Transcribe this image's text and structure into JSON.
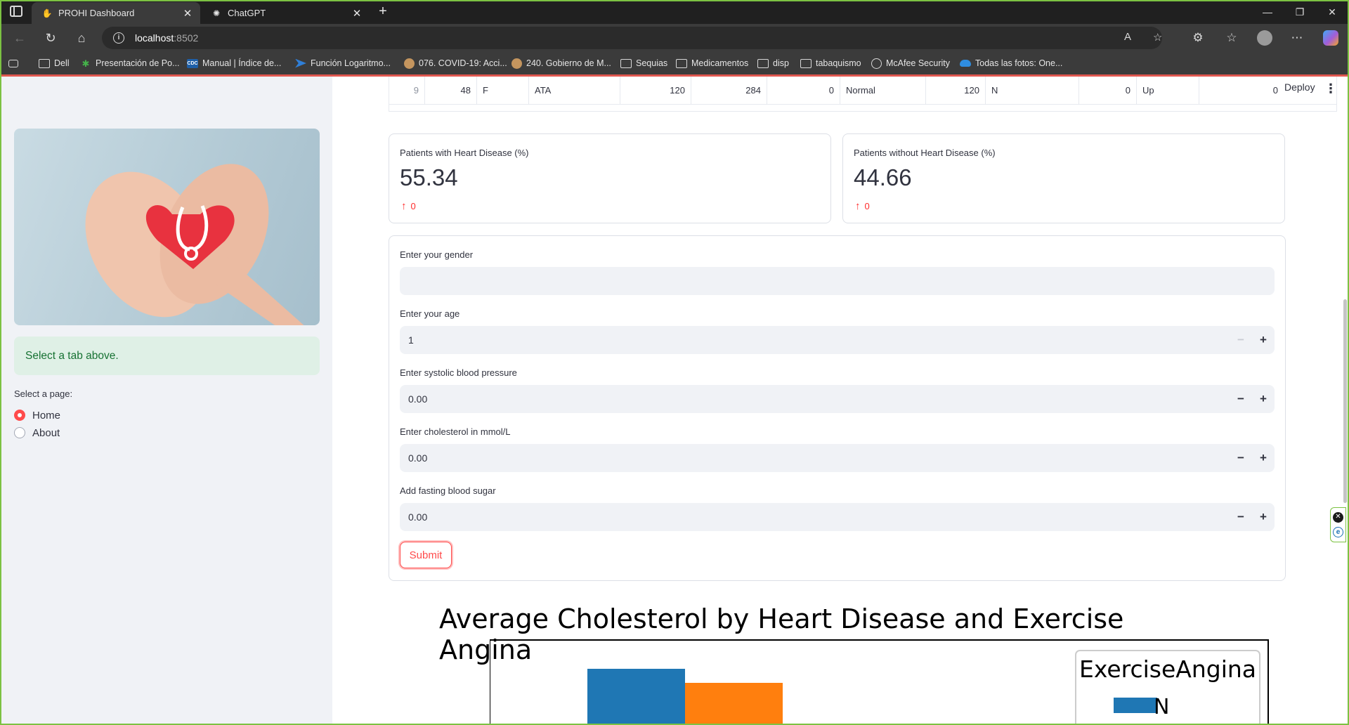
{
  "browser": {
    "tabs": [
      {
        "title": "PROHI Dashboard",
        "active": true
      },
      {
        "title": "ChatGPT",
        "active": false
      }
    ],
    "new_tab": "+",
    "url_host": "localhost",
    "url_port": ":8502",
    "bookmarks": [
      {
        "label": "Dell",
        "icon": "folder"
      },
      {
        "label": "Presentación de Po...",
        "icon": "green"
      },
      {
        "label": "Manual | Índice de...",
        "icon": "cdc"
      },
      {
        "label": "Función Logaritmo...",
        "icon": "arrow"
      },
      {
        "label": "076. COVID-19: Acci...",
        "icon": "circle"
      },
      {
        "label": "240. Gobierno de M...",
        "icon": "circle"
      },
      {
        "label": "Sequias",
        "icon": "folder"
      },
      {
        "label": "Medicamentos",
        "icon": "folder"
      },
      {
        "label": "disp",
        "icon": "folder"
      },
      {
        "label": "tabaquismo",
        "icon": "folder"
      },
      {
        "label": "McAfee Security",
        "icon": "globe"
      },
      {
        "label": "Todas las fotos: One...",
        "icon": "cloud"
      }
    ]
  },
  "sidebar": {
    "info_text": "Select a tab above.",
    "page_label": "Select a page:",
    "options": [
      {
        "label": "Home",
        "selected": true
      },
      {
        "label": "About",
        "selected": false
      }
    ]
  },
  "table": {
    "row": [
      "9",
      "48",
      "F",
      "ATA",
      "120",
      "284",
      "0",
      "Normal",
      "120",
      "N",
      "0",
      "Up",
      "0"
    ],
    "deploy_label": "Deploy"
  },
  "metrics": [
    {
      "label": "Patients with Heart Disease (%)",
      "value": "55.34",
      "delta": "0"
    },
    {
      "label": "Patients without Heart Disease (%)",
      "value": "44.66",
      "delta": "0"
    }
  ],
  "form": {
    "gender_label": "Enter your gender",
    "gender_value": "",
    "age_label": "Enter your age",
    "age_value": "1",
    "bp_label": "Enter systolic blood pressure",
    "bp_value": "0.00",
    "chol_label": "Enter cholesterol in mmol/L",
    "chol_value": "0.00",
    "sugar_label": "Add fasting blood sugar",
    "sugar_value": "0.00",
    "minus": "−",
    "plus": "+",
    "submit_label": "Submit"
  },
  "chart_data": {
    "type": "bar",
    "title": "Average Cholesterol by Heart Disease and Exercise Angina",
    "legend_title": "ExerciseAngina",
    "legend_placement": "top-right",
    "series": [
      {
        "name": "N",
        "color": "#1f77b4"
      },
      {
        "color": "#ff7f0e"
      }
    ]
  }
}
